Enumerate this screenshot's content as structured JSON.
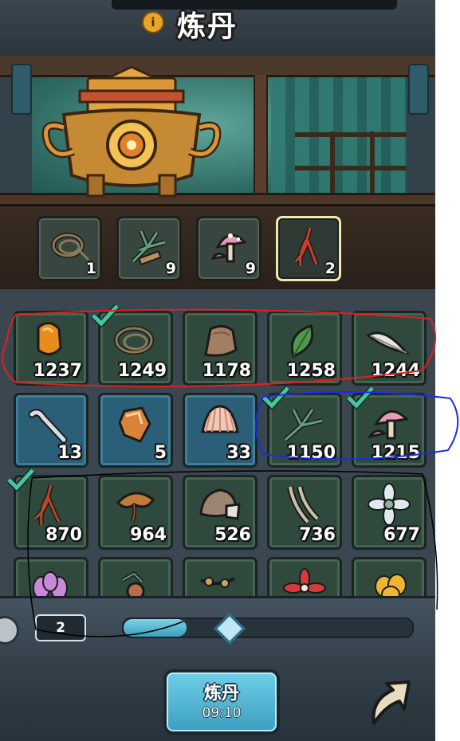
{
  "header": {
    "title": "炼丹",
    "info_icon": "info-icon"
  },
  "selected_slots": [
    {
      "item": "rope",
      "count": "1",
      "selected": false
    },
    {
      "item": "herb-grass",
      "count": "9",
      "selected": false
    },
    {
      "item": "pink-mushroom",
      "count": "9",
      "selected": false
    },
    {
      "item": "red-root",
      "count": "2",
      "selected": true
    }
  ],
  "inventory": [
    {
      "item": "amber-stone",
      "count": "1237",
      "checked": false,
      "tint": "green"
    },
    {
      "item": "rope",
      "count": "1249",
      "checked": true,
      "tint": "green"
    },
    {
      "item": "leather-scrap",
      "count": "1178",
      "checked": false,
      "tint": "green"
    },
    {
      "item": "green-leaf",
      "count": "1258",
      "checked": false,
      "tint": "green"
    },
    {
      "item": "white-feather",
      "count": "1244",
      "checked": false,
      "tint": "green"
    },
    {
      "item": "bone-branch",
      "count": "13",
      "checked": false,
      "tint": "blue"
    },
    {
      "item": "orange-crystal",
      "count": "5",
      "checked": false,
      "tint": "blue"
    },
    {
      "item": "seashell",
      "count": "33",
      "checked": false,
      "tint": "blue"
    },
    {
      "item": "herb-grass",
      "count": "1150",
      "checked": true,
      "tint": "green"
    },
    {
      "item": "pink-mushroom",
      "count": "1215",
      "checked": true,
      "tint": "green"
    },
    {
      "item": "red-root",
      "count": "870",
      "checked": true,
      "tint": "green"
    },
    {
      "item": "lingzhi-mushroom",
      "count": "964",
      "checked": false,
      "tint": "green"
    },
    {
      "item": "rock-ore",
      "count": "526",
      "checked": false,
      "tint": "green"
    },
    {
      "item": "bamboo-shoots",
      "count": "736",
      "checked": false,
      "tint": "green"
    },
    {
      "item": "white-flower",
      "count": "677",
      "checked": false,
      "tint": "green"
    },
    {
      "item": "purple-flower",
      "count": "",
      "checked": false,
      "tint": "green"
    },
    {
      "item": "berry-sprig",
      "count": "",
      "checked": false,
      "tint": "green"
    },
    {
      "item": "seed-vine",
      "count": "",
      "checked": false,
      "tint": "green"
    },
    {
      "item": "red-flower",
      "count": "",
      "checked": false,
      "tint": "green"
    },
    {
      "item": "yellow-flower",
      "count": "",
      "checked": false,
      "tint": "green"
    }
  ],
  "quantity": {
    "value": "2",
    "slider_fraction": 0.19
  },
  "craft_button": {
    "label": "炼丹",
    "timer": "09:10"
  },
  "colors": {
    "check": "#3fc9a0",
    "annotation_red": "#e02020",
    "annotation_blue": "#1a2ee0",
    "annotation_black": "#000000"
  }
}
